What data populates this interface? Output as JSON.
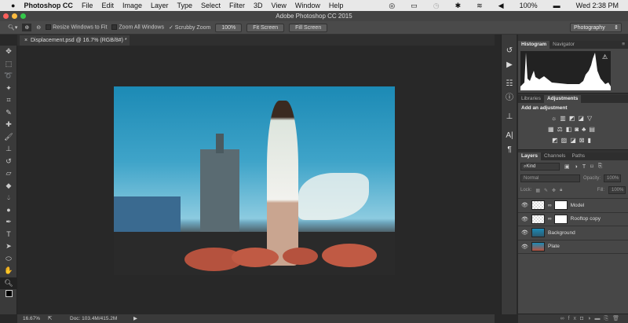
{
  "menubar": {
    "app": "Photoshop CC",
    "items": [
      "File",
      "Edit",
      "Image",
      "Layer",
      "Type",
      "Select",
      "Filter",
      "3D",
      "View",
      "Window",
      "Help"
    ],
    "battery": "100%",
    "clock": "Wed 2:38 PM"
  },
  "window": {
    "title": "Adobe Photoshop CC 2015"
  },
  "options": {
    "resize": "Resize Windows to Fit",
    "zoom_all": "Zoom All Windows",
    "scrubby": "Scrubby Zoom",
    "btn100": "100%",
    "fit": "Fit Screen",
    "fill": "Fill Screen",
    "workspace": "Photography"
  },
  "document": {
    "tab": "Displacement.psd @ 16.7% (RGB/8#) *",
    "zoom": "16.67%",
    "doc_size": "Doc: 103.4M/415.2M"
  },
  "histogram": {
    "tabs": [
      "Histogram",
      "Navigator"
    ]
  },
  "adjustments": {
    "tabs": [
      "Libraries",
      "Adjustments"
    ],
    "heading": "Add an adjustment"
  },
  "layers_panel": {
    "tabs": [
      "Layers",
      "Channels",
      "Paths"
    ],
    "kind": "Kind",
    "blend": "Normal",
    "opacity_label": "Opacity:",
    "opacity": "100%",
    "lock_label": "Lock:",
    "fill_label": "Fill:",
    "fill": "100%",
    "layers": [
      {
        "name": "Model",
        "mask": true
      },
      {
        "name": "Rooftop copy",
        "mask": true
      },
      {
        "name": "Background",
        "mask": false
      },
      {
        "name": "Plate",
        "mask": false
      }
    ]
  }
}
